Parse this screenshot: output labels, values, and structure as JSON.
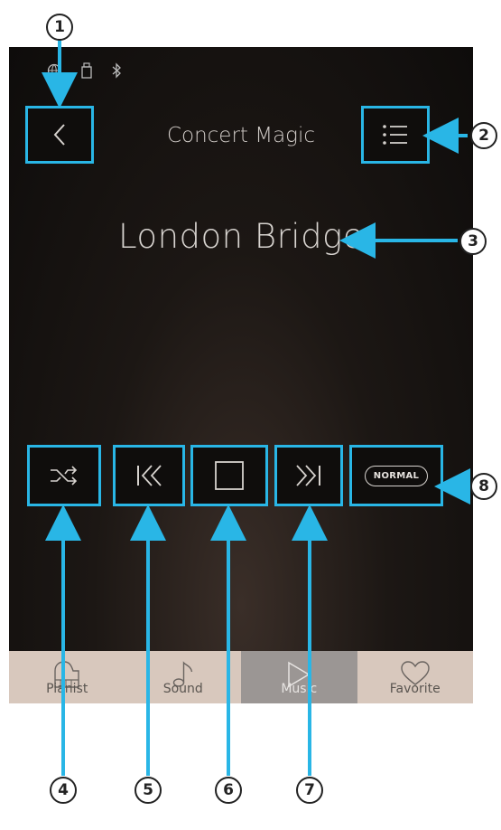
{
  "header": {
    "title": "Concert Magic"
  },
  "song": {
    "title": "London Bridge"
  },
  "controls": {
    "mode_label": "NORMAL"
  },
  "tabs": [
    {
      "label": "Pianist",
      "icon": "piano-icon"
    },
    {
      "label": "Sound",
      "icon": "music-note-icon"
    },
    {
      "label": "Music",
      "icon": "play-icon"
    },
    {
      "label": "Favorite",
      "icon": "heart-icon"
    }
  ],
  "callouts": [
    "1",
    "2",
    "3",
    "4",
    "5",
    "6",
    "7",
    "8"
  ],
  "colors": {
    "highlight": "#29b6e6",
    "tabbar": "#d8c8bd",
    "active_tab": "#9b9694"
  }
}
